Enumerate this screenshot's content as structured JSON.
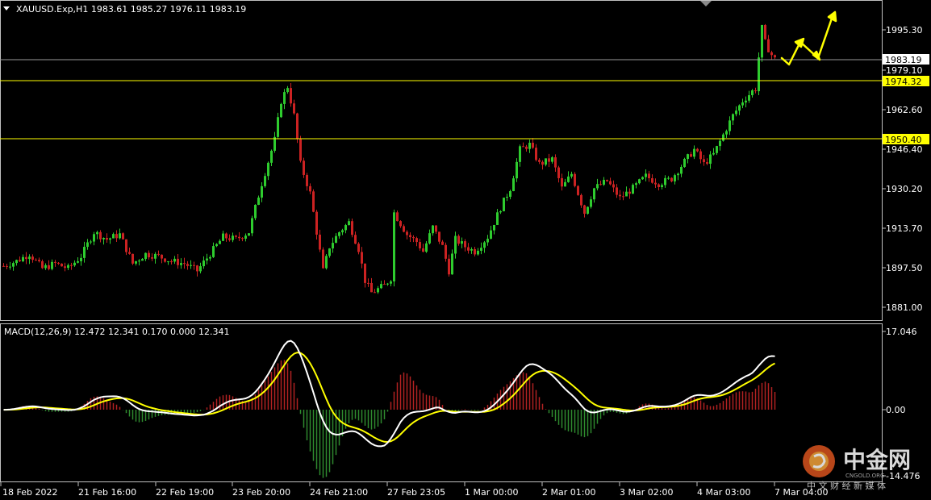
{
  "chart_data": {
    "type": "candlestick",
    "symbol_header": "XAUUSD.Exp,H1  1983.61 1985.27 1976.11 1983.19",
    "current_price_label": "1983.19",
    "price_axis": {
      "ylim": [
        1876,
        2004
      ],
      "ticks": [
        "1995.30",
        "1979.10",
        "1962.60",
        "1946.40",
        "1930.20",
        "1913.70",
        "1897.50",
        "1881.00"
      ]
    },
    "horizontal_levels": [
      {
        "label": "1974.32",
        "color": "#ffff00"
      },
      {
        "label": "1950.40",
        "color": "#ffff00"
      }
    ],
    "time_axis": [
      "18 Feb 2022",
      "21 Feb 16:00",
      "22 Feb 19:00",
      "23 Feb 20:00",
      "24 Feb 21:00",
      "27 Feb 23:05",
      "1 Mar 00:00",
      "2 Mar 01:00",
      "3 Mar 02:00",
      "4 Mar 03:00",
      "7 Mar 04:00"
    ],
    "close_path_keypoints": [
      [
        0,
        1898
      ],
      [
        4,
        1900
      ],
      [
        8,
        1903
      ],
      [
        12,
        1897
      ],
      [
        16,
        1899
      ],
      [
        20,
        1897
      ],
      [
        24,
        1902
      ],
      [
        28,
        1912
      ],
      [
        32,
        1909
      ],
      [
        36,
        1911
      ],
      [
        40,
        1899
      ],
      [
        44,
        1903
      ],
      [
        48,
        1902
      ],
      [
        52,
        1900
      ],
      [
        56,
        1899
      ],
      [
        60,
        1896
      ],
      [
        64,
        1903
      ],
      [
        68,
        1910
      ],
      [
        72,
        1909
      ],
      [
        76,
        1912
      ],
      [
        80,
        1932
      ],
      [
        84,
        1950
      ],
      [
        86,
        1966
      ],
      [
        88,
        1972
      ],
      [
        90,
        1960
      ],
      [
        92,
        1940
      ],
      [
        95,
        1928
      ],
      [
        97,
        1912
      ],
      [
        99,
        1896
      ],
      [
        101,
        1906
      ],
      [
        104,
        1912
      ],
      [
        107,
        1916
      ],
      [
        110,
        1905
      ],
      [
        112,
        1892
      ],
      [
        114,
        1887
      ],
      [
        118,
        1890
      ],
      [
        120,
        1893
      ],
      [
        121,
        1920
      ],
      [
        125,
        1911
      ],
      [
        128,
        1908
      ],
      [
        130,
        1904
      ],
      [
        133,
        1914
      ],
      [
        136,
        1906
      ],
      [
        138,
        1896
      ],
      [
        140,
        1909
      ],
      [
        143,
        1906
      ],
      [
        146,
        1904
      ],
      [
        150,
        1910
      ],
      [
        154,
        1922
      ],
      [
        157,
        1930
      ],
      [
        160,
        1946
      ],
      [
        163,
        1948
      ],
      [
        166,
        1940
      ],
      [
        170,
        1942
      ],
      [
        173,
        1930
      ],
      [
        176,
        1936
      ],
      [
        180,
        1920
      ],
      [
        183,
        1930
      ],
      [
        187,
        1933
      ],
      [
        191,
        1926
      ],
      [
        195,
        1930
      ],
      [
        199,
        1935
      ],
      [
        203,
        1932
      ],
      [
        207,
        1934
      ],
      [
        211,
        1941
      ],
      [
        214,
        1946
      ],
      [
        217,
        1940
      ],
      [
        220,
        1944
      ],
      [
        223,
        1952
      ],
      [
        226,
        1960
      ],
      [
        229,
        1966
      ],
      [
        232,
        1970
      ],
      [
        233,
        1971
      ],
      [
        234,
        1984
      ],
      [
        235,
        1996
      ],
      [
        236,
        1990
      ],
      [
        238,
        1985
      ],
      [
        239,
        1983.2
      ]
    ],
    "forecast_arrows_color": "#ffff00",
    "macd": {
      "label": "MACD(12,26,9) 12.472 12.341 0.170 0.000 12.341",
      "ticks": [
        "17.046",
        "0.00",
        "-14.476"
      ],
      "ylim": [
        -17,
        17.6
      ],
      "series": [
        {
          "color": "#ffffff"
        },
        {
          "color": "#ffff00"
        }
      ],
      "histogram_colors": {
        "positive": "#b22222",
        "negative": "#2e8b2e"
      }
    }
  },
  "watermark": {
    "text_big": "中金网",
    "text_small": "CNGOLD.ORG",
    "caption": "中 文 财 经 新 媒 体"
  },
  "colors": {
    "bull": "#2ecc2e",
    "bear": "#cc2222",
    "grid": "#c0c0c0",
    "level": "#ffff00"
  }
}
